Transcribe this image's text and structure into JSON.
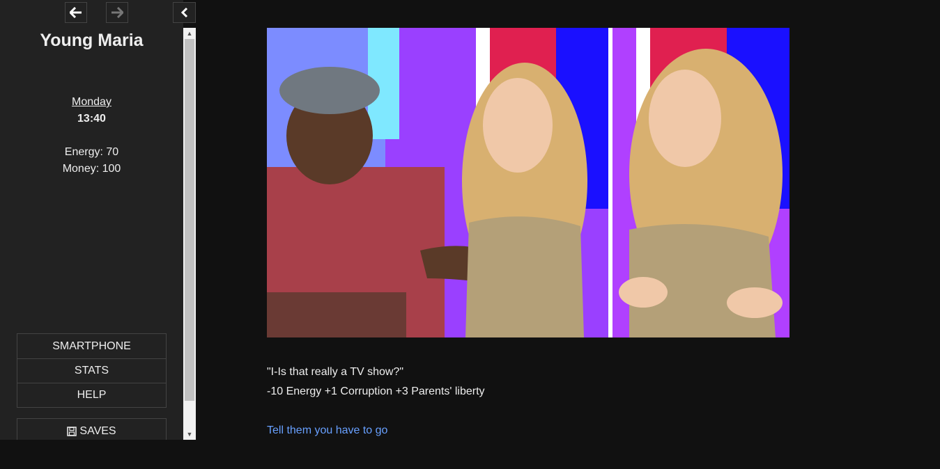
{
  "sidebar": {
    "back_icon": "arrow-left-icon",
    "forward_icon": "arrow-right-icon",
    "collapse_icon": "chevron-left-icon",
    "title": "Young Maria",
    "day": "Monday",
    "time": "13:40",
    "energy": "Energy: 70",
    "money": "Money: 100",
    "menu": [
      {
        "label": "SMARTPHONE"
      },
      {
        "label": "STATS"
      },
      {
        "label": "HELP"
      }
    ],
    "saves_label": "SAVES",
    "saves_icon": "floppy-disk-icon"
  },
  "passage": {
    "quote": "\"I-Is that really a TV show?\"",
    "effects": "-10 Energy +1 Corruption +3 Parents' liberty",
    "choice": "Tell them you have to go"
  },
  "colors": {
    "background": "#111111",
    "sidebar": "#222222",
    "link": "#68a0ff"
  }
}
